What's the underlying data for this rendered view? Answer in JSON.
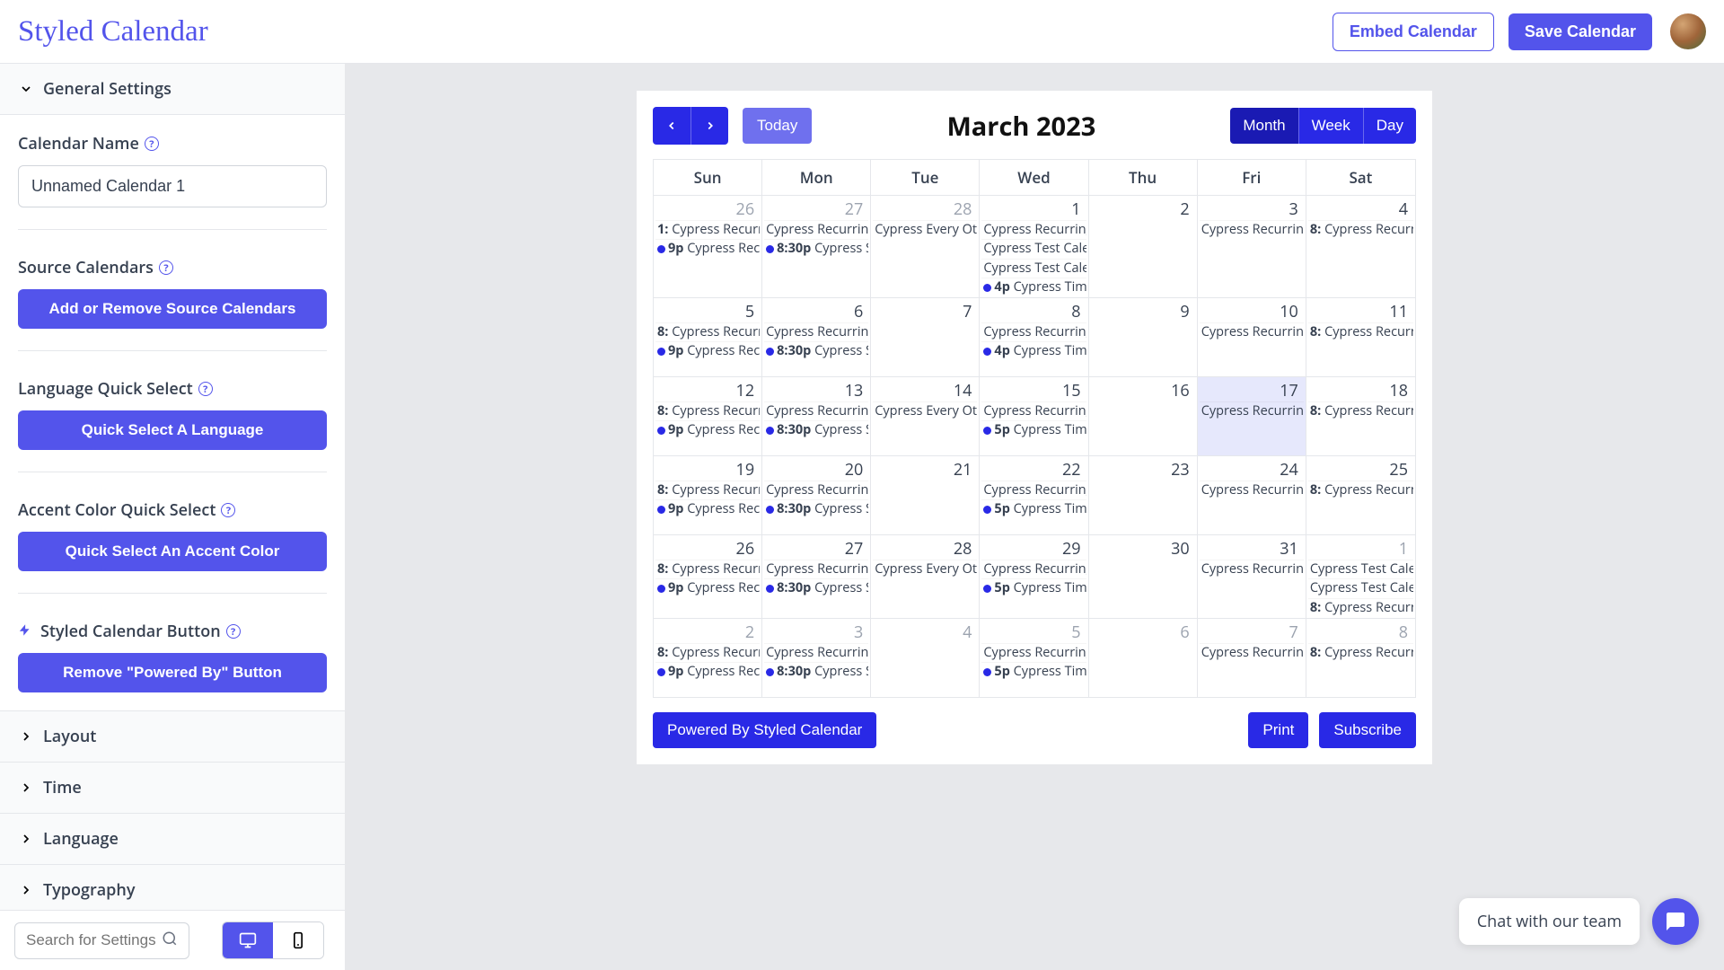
{
  "header": {
    "logo": "Styled Calendar",
    "embed": "Embed Calendar",
    "save": "Save Calendar"
  },
  "sidebar": {
    "sections": [
      {
        "title": "General Settings",
        "open": true
      },
      {
        "title": "Layout"
      },
      {
        "title": "Time"
      },
      {
        "title": "Language"
      },
      {
        "title": "Typography"
      }
    ],
    "calendarNameLabel": "Calendar Name",
    "calendarNameValue": "Unnamed Calendar 1",
    "sourceLabel": "Source Calendars",
    "sourceBtn": "Add or Remove Source Calendars",
    "langLabel": "Language Quick Select",
    "langBtn": "Quick Select A Language",
    "accentLabel": "Accent Color Quick Select",
    "accentBtn": "Quick Select An Accent Color",
    "styledBtnLabel": "Styled Calendar Button",
    "removePoweredBtn": "Remove \"Powered By\" Button",
    "searchPlaceholder": "Search for Settings"
  },
  "cal": {
    "title": "March 2023",
    "today": "Today",
    "views": [
      "Month",
      "Week",
      "Day"
    ],
    "dayNames": [
      "Sun",
      "Mon",
      "Tue",
      "Wed",
      "Thu",
      "Fri",
      "Sat"
    ],
    "powered": "Powered By Styled Calendar",
    "print": "Print",
    "subscribe": "Subscribe",
    "cells": [
      {
        "n": "26",
        "out": 1,
        "ev": [
          {
            "pre": "1:",
            "txt": "Cypress Recurrin"
          },
          {
            "dot": 1,
            "t": "9p",
            "txt": "Cypress Recu"
          }
        ]
      },
      {
        "n": "27",
        "out": 1,
        "ev": [
          {
            "txt": "Cypress Recurring"
          },
          {
            "dot": 1,
            "t": "8:30p",
            "txt": "Cypress S"
          }
        ]
      },
      {
        "n": "28",
        "out": 1,
        "ev": [
          {
            "txt": "Cypress Every Othe"
          }
        ]
      },
      {
        "n": "1",
        "ev": [
          {
            "txt": "Cypress Recurring"
          },
          {
            "txt": "Cypress Test Calen"
          },
          {
            "txt": "Cypress Test Calen"
          },
          {
            "dot": 1,
            "t": "4p",
            "txt": "Cypress Time"
          }
        ]
      },
      {
        "n": "2",
        "ev": []
      },
      {
        "n": "3",
        "ev": [
          {
            "txt": "Cypress Recurring"
          }
        ]
      },
      {
        "n": "4",
        "ev": [
          {
            "pre": "8:",
            "txt": "Cypress Recurrin"
          }
        ]
      },
      {
        "n": "5",
        "ev": [
          {
            "pre": "8:",
            "txt": "Cypress Recurrin"
          },
          {
            "dot": 1,
            "t": "9p",
            "txt": "Cypress Recu"
          }
        ]
      },
      {
        "n": "6",
        "ev": [
          {
            "txt": "Cypress Recurring"
          },
          {
            "dot": 1,
            "t": "8:30p",
            "txt": "Cypress S"
          }
        ]
      },
      {
        "n": "7",
        "ev": []
      },
      {
        "n": "8",
        "ev": [
          {
            "txt": "Cypress Recurring"
          },
          {
            "dot": 1,
            "t": "4p",
            "txt": "Cypress Time"
          }
        ]
      },
      {
        "n": "9",
        "ev": []
      },
      {
        "n": "10",
        "ev": [
          {
            "txt": "Cypress Recurring"
          }
        ]
      },
      {
        "n": "11",
        "ev": [
          {
            "pre": "8:",
            "txt": "Cypress Recurrin"
          }
        ]
      },
      {
        "n": "12",
        "ev": [
          {
            "pre": "8:",
            "txt": "Cypress Recurrin"
          },
          {
            "dot": 1,
            "t": "9p",
            "txt": "Cypress Recu"
          }
        ]
      },
      {
        "n": "13",
        "ev": [
          {
            "txt": "Cypress Recurring"
          },
          {
            "dot": 1,
            "t": "8:30p",
            "txt": "Cypress S"
          }
        ]
      },
      {
        "n": "14",
        "ev": [
          {
            "txt": "Cypress Every Othe"
          }
        ]
      },
      {
        "n": "15",
        "ev": [
          {
            "txt": "Cypress Recurring"
          },
          {
            "dot": 1,
            "t": "5p",
            "txt": "Cypress Time"
          }
        ]
      },
      {
        "n": "16",
        "ev": []
      },
      {
        "n": "17",
        "today": 1,
        "ev": [
          {
            "txt": "Cypress Recurring"
          }
        ]
      },
      {
        "n": "18",
        "ev": [
          {
            "pre": "8:",
            "txt": "Cypress Recurrin"
          }
        ]
      },
      {
        "n": "19",
        "ev": [
          {
            "pre": "8:",
            "txt": "Cypress Recurrin"
          },
          {
            "dot": 1,
            "t": "9p",
            "txt": "Cypress Recu"
          }
        ]
      },
      {
        "n": "20",
        "ev": [
          {
            "txt": "Cypress Recurring"
          },
          {
            "dot": 1,
            "t": "8:30p",
            "txt": "Cypress S"
          }
        ]
      },
      {
        "n": "21",
        "ev": []
      },
      {
        "n": "22",
        "ev": [
          {
            "txt": "Cypress Recurring"
          },
          {
            "dot": 1,
            "t": "5p",
            "txt": "Cypress Time"
          }
        ]
      },
      {
        "n": "23",
        "ev": []
      },
      {
        "n": "24",
        "ev": [
          {
            "txt": "Cypress Recurring"
          }
        ]
      },
      {
        "n": "25",
        "ev": [
          {
            "pre": "8:",
            "txt": "Cypress Recurrin"
          }
        ]
      },
      {
        "n": "26",
        "ev": [
          {
            "pre": "8:",
            "txt": "Cypress Recurrin"
          },
          {
            "dot": 1,
            "t": "9p",
            "txt": "Cypress Recu"
          }
        ]
      },
      {
        "n": "27",
        "ev": [
          {
            "txt": "Cypress Recurring"
          },
          {
            "dot": 1,
            "t": "8:30p",
            "txt": "Cypress S"
          }
        ]
      },
      {
        "n": "28",
        "ev": [
          {
            "txt": "Cypress Every Othe"
          }
        ]
      },
      {
        "n": "29",
        "ev": [
          {
            "txt": "Cypress Recurring"
          },
          {
            "dot": 1,
            "t": "5p",
            "txt": "Cypress Time"
          }
        ]
      },
      {
        "n": "30",
        "ev": []
      },
      {
        "n": "31",
        "ev": [
          {
            "txt": "Cypress Recurring"
          }
        ]
      },
      {
        "n": "1",
        "out": 1,
        "ev": [
          {
            "txt": "Cypress Test Calen"
          },
          {
            "txt": "Cypress Test Calen"
          },
          {
            "pre": "8:",
            "txt": "Cypress Recurrin"
          }
        ]
      },
      {
        "n": "2",
        "out": 1,
        "ev": [
          {
            "pre": "8:",
            "txt": "Cypress Recurrin"
          },
          {
            "dot": 1,
            "t": "9p",
            "txt": "Cypress Recu"
          }
        ]
      },
      {
        "n": "3",
        "out": 1,
        "ev": [
          {
            "txt": "Cypress Recurring"
          },
          {
            "dot": 1,
            "t": "8:30p",
            "txt": "Cypress S"
          }
        ]
      },
      {
        "n": "4",
        "out": 1,
        "ev": []
      },
      {
        "n": "5",
        "out": 1,
        "ev": [
          {
            "txt": "Cypress Recurring"
          },
          {
            "dot": 1,
            "t": "5p",
            "txt": "Cypress Time"
          }
        ]
      },
      {
        "n": "6",
        "out": 1,
        "ev": []
      },
      {
        "n": "7",
        "out": 1,
        "ev": [
          {
            "txt": "Cypress Recurring"
          }
        ]
      },
      {
        "n": "8",
        "out": 1,
        "ev": [
          {
            "pre": "8:",
            "txt": "Cypress Recurrin"
          }
        ]
      }
    ]
  },
  "chat": {
    "text": "Chat with our team"
  }
}
